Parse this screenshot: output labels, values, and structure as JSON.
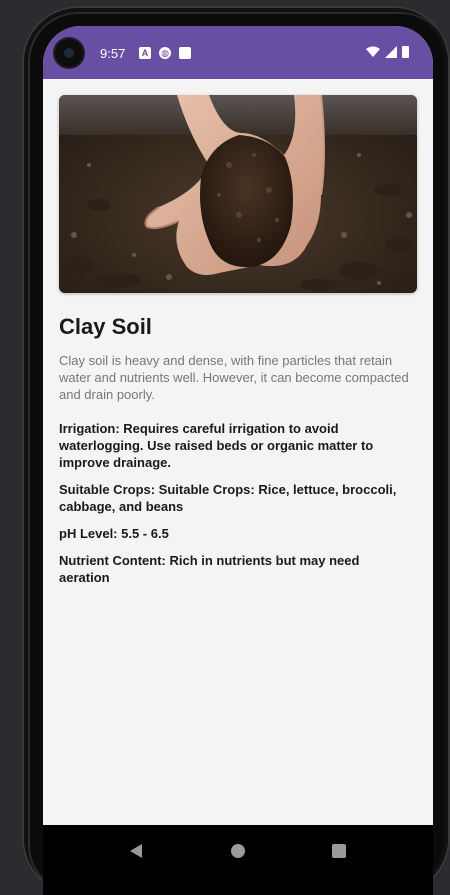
{
  "status_bar": {
    "time": "9:57",
    "icons": [
      "text-a-icon",
      "shield-icon",
      "sd-card-icon"
    ],
    "right_icons": [
      "wifi-icon",
      "cellular-icon",
      "battery-icon"
    ],
    "color": "#6750a4"
  },
  "soil": {
    "title": "Clay Soil",
    "image_alt": "soil-in-hands-image",
    "description": "Clay soil is heavy and dense, with fine particles that retain water and nutrients well. However, it can become compacted and drain poorly.",
    "irrigation": "Irrigation: Requires careful irrigation to avoid waterlogging. Use raised beds or organic matter to improve drainage.",
    "crops": "Suitable Crops: Suitable Crops: Rice, lettuce, broccoli, cabbage, and beans",
    "ph": "pH Level: 5.5 - 6.5",
    "nutrients": "Nutrient Content: Rich in nutrients but may need aeration"
  },
  "nav": {
    "back": "back-icon",
    "home": "home-icon",
    "recents": "recents-icon"
  }
}
